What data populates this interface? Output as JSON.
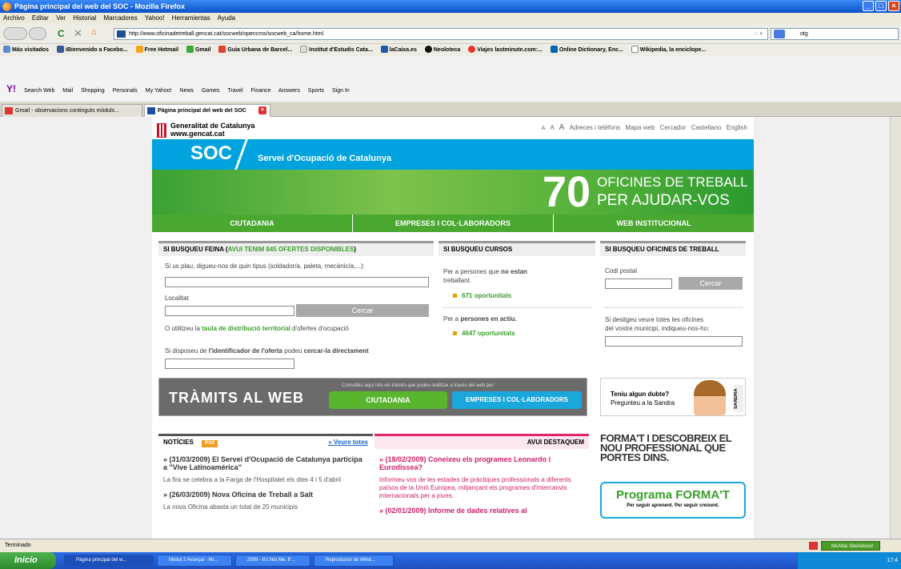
{
  "window": {
    "title": "Página principal del web del SOC - Mozilla Firefox"
  },
  "menu": [
    "Archivo",
    "Editar",
    "Ver",
    "Historial",
    "Marcadores",
    "Yahoo!",
    "Herramientas",
    "Ayuda"
  ],
  "address": {
    "url": "http://www.oficinadetreball.gencat.cat/socweb/opencms/socweb_ca/home.html"
  },
  "search": {
    "value": "otg"
  },
  "bookmarks": [
    "Más visitados",
    "iBienvenido a Facebo...",
    "Free Hotmail",
    "Gmail",
    "Guia Urbana de Barcel...",
    "Institut d'Estudis Cata...",
    "laCaixa.es",
    "Neoloteca",
    "Viajes lastminute.com:...",
    "Online Dictionary, Enc...",
    "Wikipedia, la enciclope..."
  ],
  "yahoo": {
    "items": [
      "Search Web",
      "Mail",
      "Shopping",
      "Personals",
      "My Yahoo!",
      "News",
      "Games",
      "Travel",
      "Finance",
      "Answers",
      "Sports",
      "Sign In"
    ]
  },
  "tabs": [
    {
      "label": "Gmail - observacions continguts mòduls..."
    },
    {
      "label": "Pàgina principal del web del SOC"
    }
  ],
  "site": {
    "gencat_name": "Generalitat de Catalunya",
    "gencat_url": "www.gencat.cat",
    "toplinks": [
      "A",
      "A",
      "A",
      "Adreces i telèfons",
      "Mapa web",
      "Cercador",
      "Castellano",
      "English"
    ],
    "soc": "SOC",
    "soc_full": "Servei d'Ocupació de Catalunya",
    "banner_number": "70",
    "banner_line1": "OFICINES DE TREBALL",
    "banner_line2": "PER AJUDAR-VOS",
    "nav": [
      "CIUTADANIA",
      "EMPRESES I COL·LABORADORS",
      "WEB INSTITUCIONAL"
    ]
  },
  "feina": {
    "title": "SI BUSQUEU FEINA (",
    "highlight": "AVUI TENIM 845 OFERTES DISPONIBLES",
    "title_end": ")",
    "label1": "Si us plau, digueu-nos de quin tipus (soldador/a, paleta, mecànic/a,...):",
    "label2": "Localitat",
    "button": "Cercar",
    "line1a": "O utilitzeu la ",
    "line1b": "taula de distribució territorial",
    "line1c": " d'ofertes d'ocupació",
    "line2a": "Si disposeu de ",
    "line2b": "l'identificador de l'oferta",
    "line2c": " podeu ",
    "line2d": "cercar-la directament"
  },
  "cursos": {
    "title": "SI BUSQUEU CURSOS",
    "t1a": "Per a persones que ",
    "t1b": "no estan",
    "t1c": "treballant.",
    "l1": "671 oportunitats",
    "t2a": "Per a ",
    "t2b": "persones en actiu.",
    "l2": "4647 oportunitats"
  },
  "oficines": {
    "title": "SI BUSQUEU OFICINES DE TREBALL",
    "label": "Codi postal",
    "button": "Cercar",
    "text1": "Si desitgeu veure totes les oficines",
    "text2": "del vostre municipi, indiqueu-nos-ho:"
  },
  "tramits": {
    "title": "TRÀMITS AL WEB",
    "info": "Consulteu aquí tots els tràmits que podeu realitzar a través del web per:",
    "b1": "CIUTADANIA",
    "b2": "EMPRESES I COL·LABORADORS"
  },
  "sandra": {
    "q": "Teniu algun dubte?",
    "q2": "Pregunteu a la Sandra",
    "tag": "SANDRA"
  },
  "noticies": {
    "title": "NOTÍCIES",
    "rss": "RSS",
    "more": "» Veure totes",
    "items": [
      {
        "title": "» (31/03/2009) El Servei d'Ocupació de Catalunya participa a \"Vive Latinoamérica\"",
        "text": "La fira se celebra a la Farga de l'Hospitalet els dies 4 i 5 d'abril"
      },
      {
        "title": "» (26/03/2009) Nova Oficina de Treball a Salt",
        "text": "La nova Oficina abasta un total de 20 municipis"
      }
    ]
  },
  "destaquem": {
    "title": "AVUI DESTAQUEM",
    "items": [
      {
        "title": "» (18/02/2009) Coneixeu els programes Leonardo i Eurodissea?",
        "text": "Informeu-vos de les estades de pràctiques professionals a diferents països de la Unió Europea, mitjançant els programes d'intercanvis internacionals per a joves."
      },
      {
        "title": "» (02/01/2009) Informe de dades relatives al",
        "text": ""
      }
    ]
  },
  "forma": {
    "text": "FORMA'T I DESCOBREIX EL NOU PROFESSIONAL QUE PORTES DINS.",
    "prog": "Programa FORMA'T",
    "sub": "Per seguir aprenent. Per seguir creixent."
  },
  "status": {
    "text": "Terminado",
    "mcafee": "McAfee SiteAdvisor"
  },
  "taskbar": {
    "start": "Inicio",
    "tasks": [
      "Pàgina principal del w...",
      "Mòdul 2 Avançat - Mi...",
      "2009 - It's Not Me, It'...",
      "Reproductor de Wind..."
    ],
    "clock": "17:4"
  }
}
